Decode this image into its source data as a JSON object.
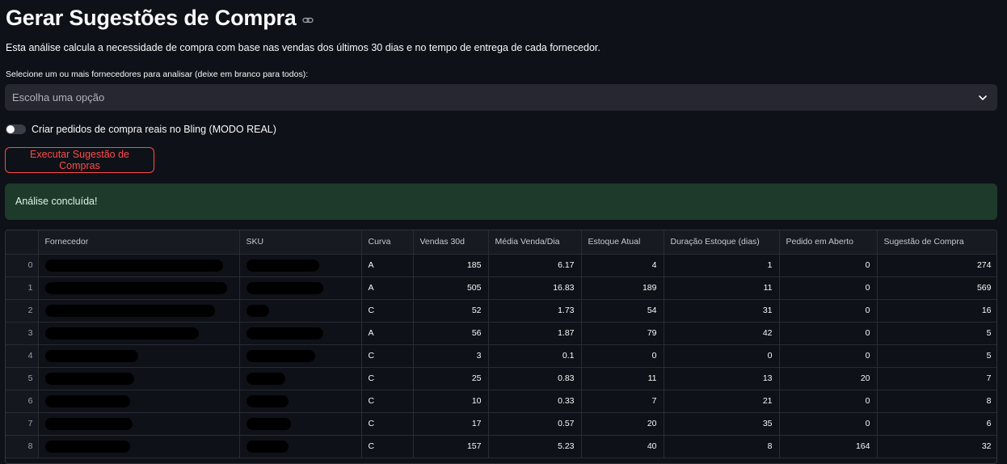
{
  "header": {
    "title": "Gerar Sugestões de Compra"
  },
  "description": "Esta análise calcula a necessidade de compra com base nas vendas dos últimos 30 dias e no tempo de entrega de cada fornecedor.",
  "supplier_select": {
    "label": "Selecione um ou mais fornecedores para analisar (deixe em branco para todos):",
    "placeholder": "Escolha uma opção"
  },
  "toggle": {
    "label": "Criar pedidos de compra reais no Bling (MODO REAL)",
    "checked": false
  },
  "run_button": {
    "label": "Executar Sugestão de Compras",
    "color": "#ff4b4b"
  },
  "alert": {
    "text": "Análise concluída!",
    "color": "#1d3a2b"
  },
  "table": {
    "columns": [
      "",
      "Fornecedor",
      "SKU",
      "Curva",
      "Vendas 30d",
      "Média Venda/Dia",
      "Estoque Atual",
      "Duração Estoque (dias)",
      "Pedido em Aberto",
      "Sugestão de Compra"
    ],
    "rows": [
      {
        "index": "0",
        "curva": "A",
        "vendas": "185",
        "media": "6.17",
        "estoque": "4",
        "duracao": "1",
        "pedido": "0",
        "sugestao": "274"
      },
      {
        "index": "1",
        "curva": "A",
        "vendas": "505",
        "media": "16.83",
        "estoque": "189",
        "duracao": "11",
        "pedido": "0",
        "sugestao": "569"
      },
      {
        "index": "2",
        "curva": "C",
        "vendas": "52",
        "media": "1.73",
        "estoque": "54",
        "duracao": "31",
        "pedido": "0",
        "sugestao": "16"
      },
      {
        "index": "3",
        "curva": "A",
        "vendas": "56",
        "media": "1.87",
        "estoque": "79",
        "duracao": "42",
        "pedido": "0",
        "sugestao": "5"
      },
      {
        "index": "4",
        "curva": "C",
        "vendas": "3",
        "media": "0.1",
        "estoque": "0",
        "duracao": "0",
        "pedido": "0",
        "sugestao": "5"
      },
      {
        "index": "5",
        "curva": "C",
        "vendas": "25",
        "media": "0.83",
        "estoque": "11",
        "duracao": "13",
        "pedido": "20",
        "sugestao": "7"
      },
      {
        "index": "6",
        "curva": "C",
        "vendas": "10",
        "media": "0.33",
        "estoque": "7",
        "duracao": "21",
        "pedido": "0",
        "sugestao": "8"
      },
      {
        "index": "7",
        "curva": "C",
        "vendas": "17",
        "media": "0.57",
        "estoque": "20",
        "duracao": "35",
        "pedido": "0",
        "sugestao": "6"
      },
      {
        "index": "8",
        "curva": "C",
        "vendas": "157",
        "media": "5.23",
        "estoque": "40",
        "duracao": "8",
        "pedido": "164",
        "sugestao": "32"
      }
    ]
  }
}
